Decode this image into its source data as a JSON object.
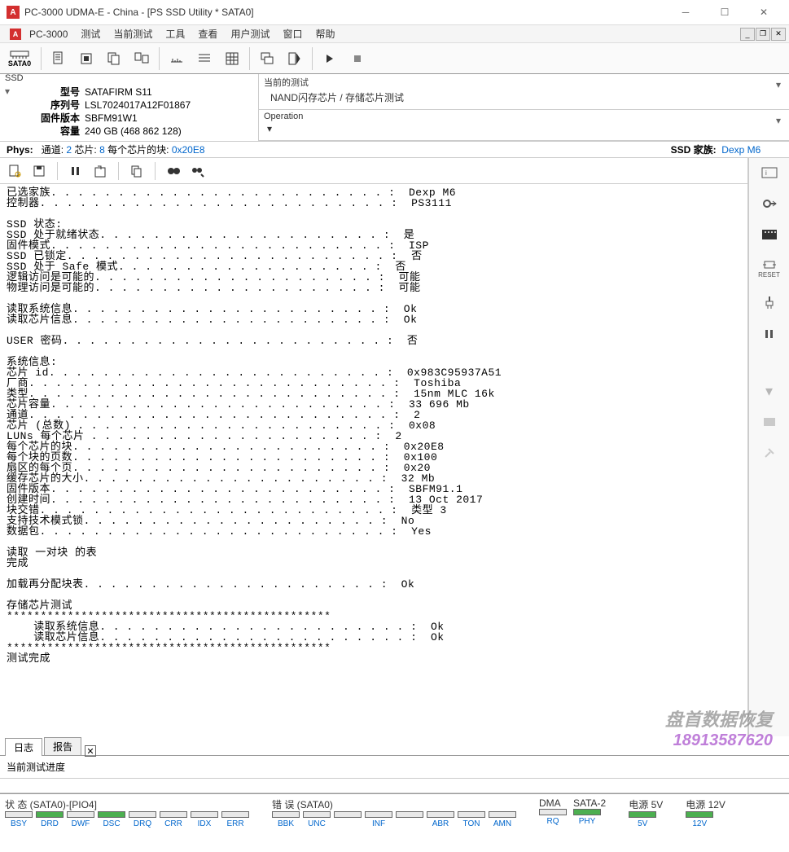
{
  "title": "PC-3000 UDMA-E - China - [PS SSD Utility * SATA0]",
  "menu": {
    "app": "PC-3000",
    "items": [
      "测试",
      "当前测试",
      "工具",
      "查看",
      "用户测试",
      "窗口",
      "帮助"
    ]
  },
  "toolbar_sata": "SATA0",
  "ssd": {
    "header": "SSD",
    "labels": {
      "model": "型号",
      "serial": "序列号",
      "firmware": "固件版本",
      "capacity": "容量"
    },
    "model": "SATAFIRM   S11",
    "serial": "LSL7024017A12F01867",
    "firmware": "SBFM91W1",
    "capacity": "240 GB (468 862 128)"
  },
  "current_test": {
    "header": "当前的测试",
    "value": "NAND闪存芯片 / 存储芯片测试"
  },
  "operation": {
    "header": "Operation"
  },
  "phys": {
    "label": "Phys:",
    "channel_label": "通道:",
    "channel": "2",
    "chips_label": "芯片:",
    "chips": "8",
    "blocks_label": "每个芯片的块:",
    "blocks": "0x20E8",
    "ssd_family_label": "SSD 家族:",
    "ssd_family": "Dexp M6"
  },
  "log": "已选家族. . . . . . . . . . . . . . . . . . . . . . . . . :  Dexp M6\n控制器. . . . . . . . . . . . . . . . . . . . . . . . . . :  PS3111\n\nSSD 状态:\nSSD 处于就绪状态. . . . . . . . . . . . . . . . . . . . . :  是\n固件模式. . . . . . . . . . . . . . . . . . . . . . . . . :  ISP\nSSD 已锁定. . . . . . . . . . . . . . . . . . . . . . . . :  否\nSSD 处于 Safe 模式. . . . . . . . . . . . . . . . . . . :  否\n逻辑访问是可能的. . . . . . . . . . . . . . . . . . . . . :  可能\n物理访问是可能的. . . . . . . . . . . . . . . . . . . . . :  可能\n\n读取系统信息. . . . . . . . . . . . . . . . . . . . . . . :  Ok\n读取芯片信息. . . . . . . . . . . . . . . . . . . . . . . :  Ok\n\nUSER 密码. . . . . . . . . . . . . . . . . . . . . . . . :  否\n\n系统信息:\n芯片 id. . . . . . . . . . . . . . . . . . . . . . . . . :  0x983C95937A51\n厂商. . . . . . . . . . . . . . . . . . . . . . . . . . . :  Toshiba\n类型. . . . . . . . . . . . . . . . . . . . . . . . . . . :  15nm MLC 16k\n芯片容量. . . . . . . . . . . . . . . . . . . . . . . . . :  33 696 Mb\n通道. . . . . . . . . . . . . . . . . . . . . . . . . . . :  2\n芯片 (总数) . . . . . . . . . . . . . . . . . . . . . . . :  0x08\nLUNs 每个芯片 . . . . . . . . . . . . . . . . . . . . . :  2\n每个芯片的块. . . . . . . . . . . . . . . . . . . . . . . :  0x20E8\n每个块的页数. . . . . . . . . . . . . . . . . . . . . . . :  0x100\n扇区的每个页. . . . . . . . . . . . . . . . . . . . . . . :  0x20\n缓存芯片的大小. . . . . . . . . . . . . . . . . . . . . . :  32 Mb\n固件版本. . . . . . . . . . . . . . . . . . . . . . . . . :  SBFM91.1\n创建时间. . . . . . . . . . . . . . . . . . . . . . . . . :  13 Oct 2017\n块交错. . . . . . . . . . . . . . . . . . . . . . . . . . :  类型 3\n支持技术模式锁. . . . . . . . . . . . . . . . . . . . . . :  No\n数据包. . . . . . . . . . . . . . . . . . . . . . . . . . :  Yes\n\n读取 一对块 的表\n完成\n\n加载再分配块表. . . . . . . . . . . . . . . . . . . . . . :  Ok\n\n存储芯片测试\n************************************************\n    读取系统信息. . . . . . . . . . . . . . . . . . . . . . . :  Ok\n    读取芯片信息. . . . . . . . . . . . . . . . . . . . . . . :  Ok\n************************************************\n测试完成",
  "tabs": {
    "log": "日志",
    "report": "报告"
  },
  "progress_label": "当前测试进度",
  "watermark": {
    "line1": "盘首数据恢复",
    "line2": "18913587620"
  },
  "status": {
    "group1": "状 态 (SATA0)-[PIO4]",
    "group2": "错 误 (SATA0)",
    "group3": "DMA",
    "group4": "SATA-2",
    "group5": "电源 5V",
    "group6": "电源 12V",
    "leds1": [
      "BSY",
      "DRD",
      "DWF",
      "DSC",
      "DRQ",
      "CRR",
      "IDX",
      "ERR"
    ],
    "leds2": [
      "BBK",
      "UNC",
      "",
      "INF",
      "",
      "ABR",
      "TON",
      "AMN"
    ],
    "leds3": [
      "RQ"
    ],
    "leds4": [
      "PHY"
    ],
    "leds5": [
      "5V"
    ],
    "leds6": [
      "12V"
    ],
    "lit": {
      "DRD": true,
      "DSC": true,
      "PHY": true,
      "5V": true,
      "12V": true
    }
  },
  "side_reset": "RESET"
}
